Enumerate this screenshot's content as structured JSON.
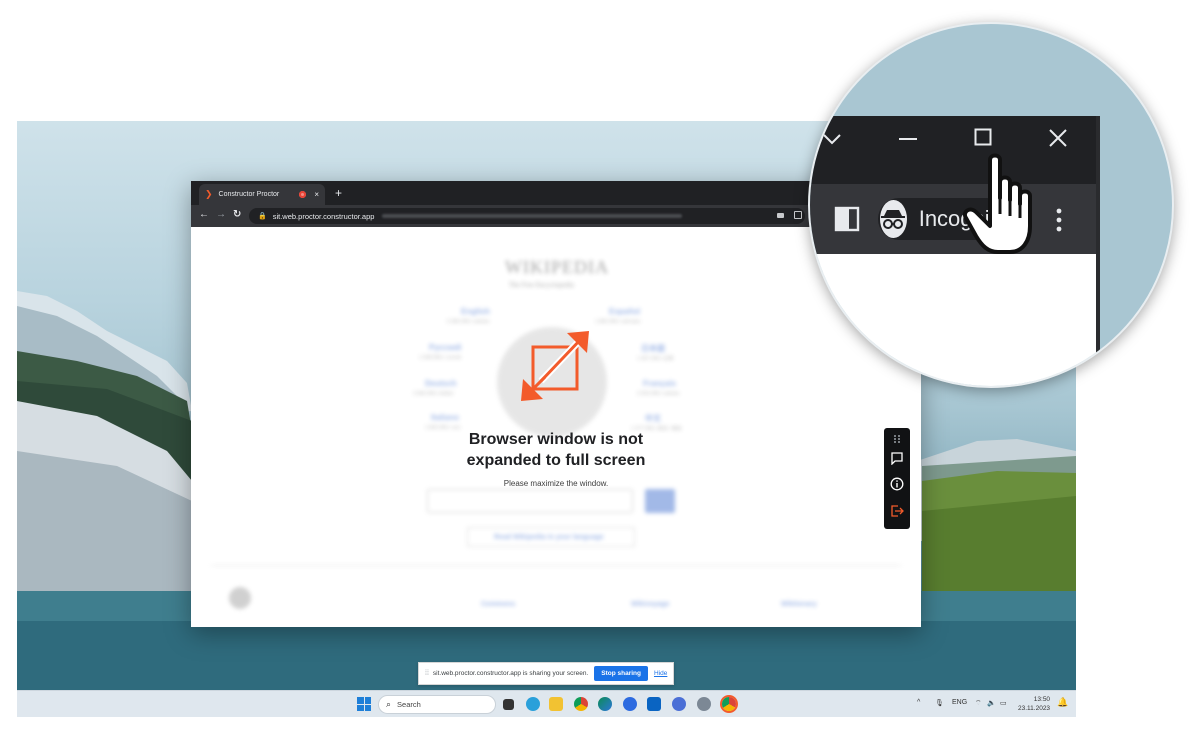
{
  "browser": {
    "tab_title": "Constructor Proctor",
    "tab_close": "×",
    "new_tab": "+",
    "url": "sit.web.proctor.constructor.app"
  },
  "wiki": {
    "logo_text": "WIKIPEDIA",
    "tagline": "The Free Encyclopedia",
    "languages": [
      {
        "name": "English",
        "sub": "6 383 000+ articles"
      },
      {
        "name": "Español",
        "sub": "1 892 000+ artículos"
      },
      {
        "name": "Русский",
        "sub": "1 938 000+ статей"
      },
      {
        "name": "日本語",
        "sub": "1 407 000+ 記事"
      },
      {
        "name": "Deutsch",
        "sub": "2 836 000+ Artikel"
      },
      {
        "name": "Français",
        "sub": "2 553 000+ articles"
      },
      {
        "name": "Italiano",
        "sub": "1 826 000+ voci"
      },
      {
        "name": "中文",
        "sub": "1 377 000+ 条目 / 條目"
      }
    ],
    "read_language": "Read Wikipedia in your language",
    "footer_1": "Commons",
    "footer_2": "Wikivoyage",
    "footer_3": "Wiktionary"
  },
  "overlay": {
    "title_line1": "Browser window is not",
    "title_line2": "expanded to full screen",
    "subtitle": "Please maximize the window.",
    "accent": "#f35b2b"
  },
  "sharebar": {
    "message": "sit.web.proctor.constructor.app is sharing your screen.",
    "stop_label": "Stop sharing",
    "hide_label": "Hide"
  },
  "taskbar": {
    "search_label": "Search",
    "language": "ENG",
    "time": "13:50",
    "date": "23.11.2023"
  },
  "magnifier": {
    "incognito_label": "Incognito"
  }
}
